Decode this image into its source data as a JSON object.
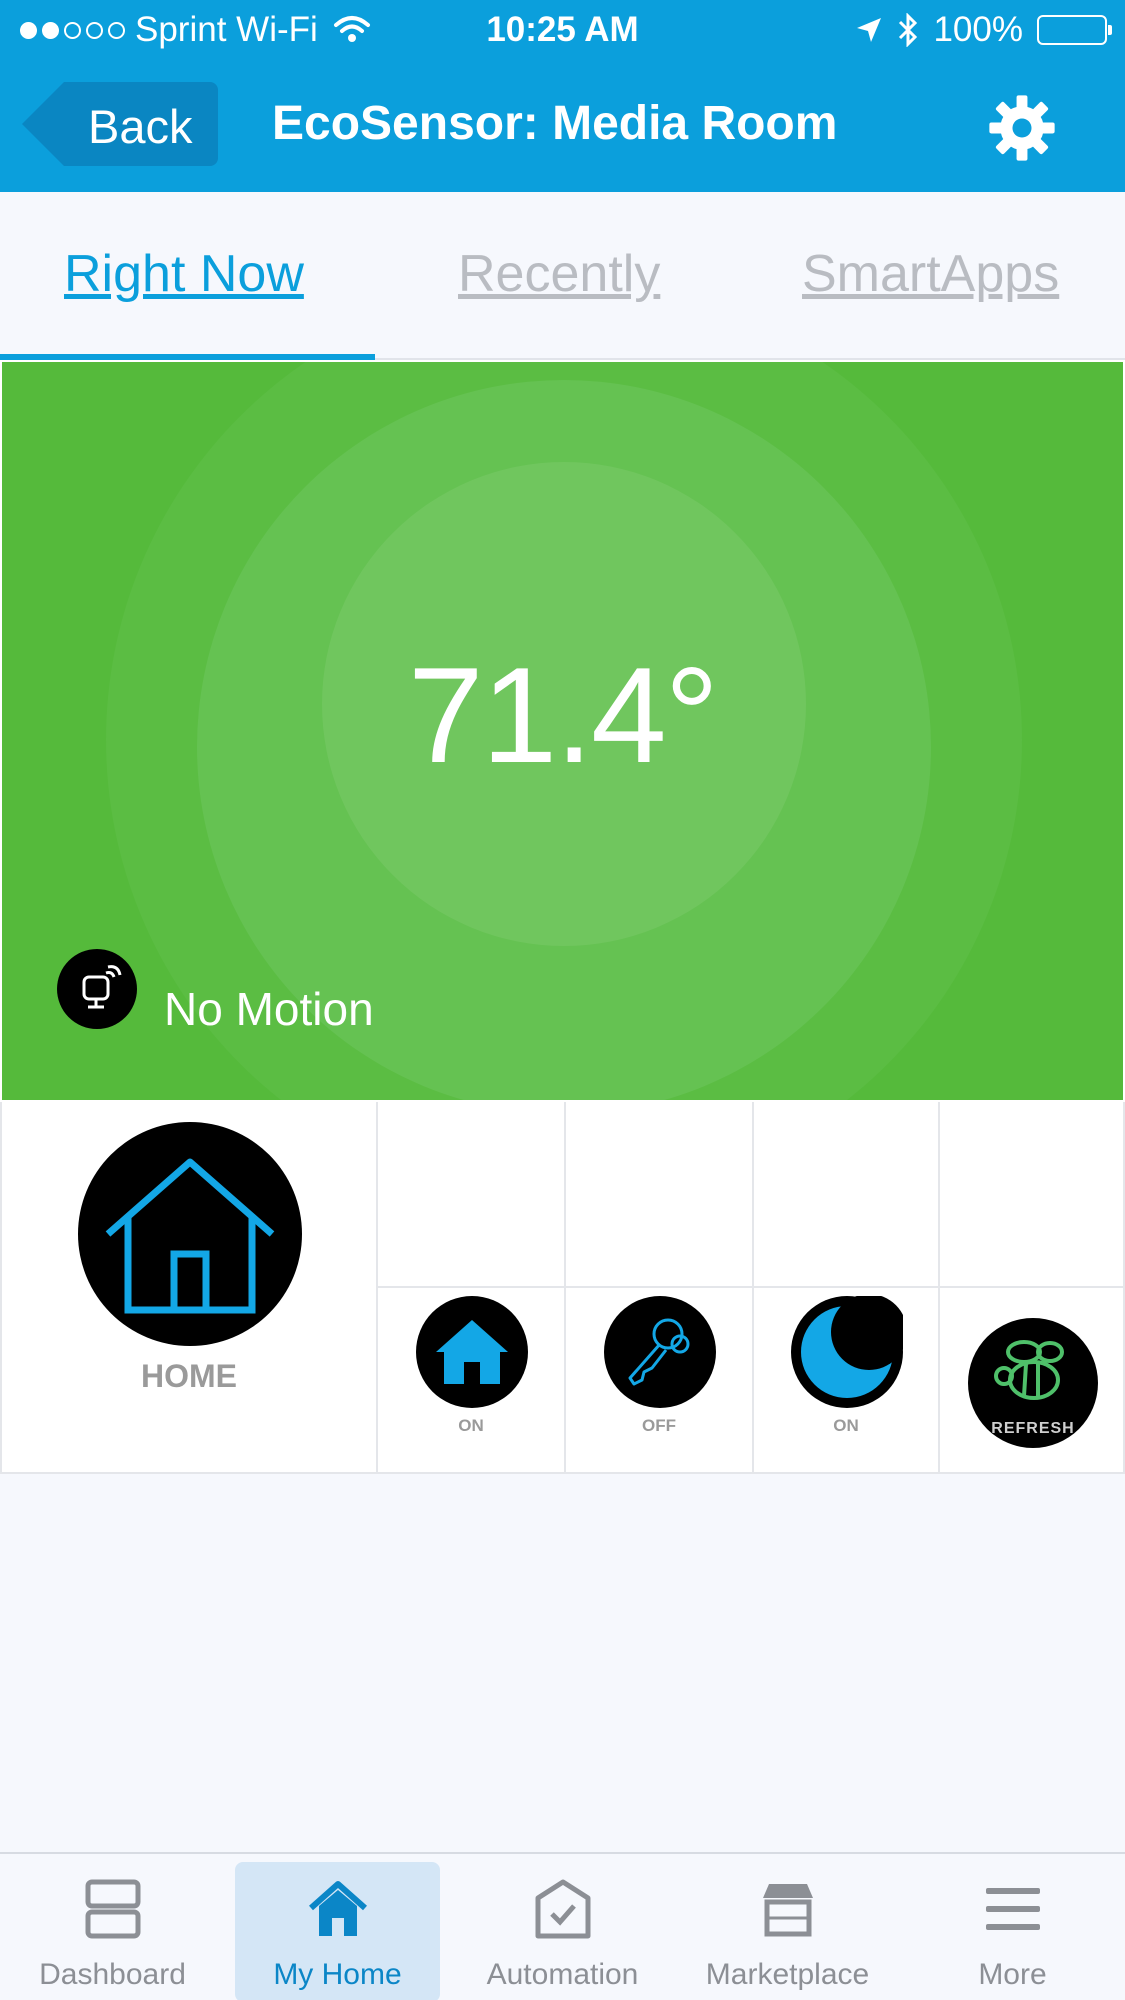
{
  "status_bar": {
    "carrier": "Sprint Wi-Fi",
    "time": "10:25 AM",
    "battery": "100%",
    "signal_bars": 2
  },
  "nav": {
    "back_label": "Back",
    "title": "EcoSensor: Media Room",
    "settings_icon": "gear-icon"
  },
  "tabs": [
    {
      "label": "Right Now",
      "active": true
    },
    {
      "label": "Recently",
      "active": false
    },
    {
      "label": "SmartApps",
      "active": false
    }
  ],
  "sensor": {
    "temperature": "71.4°",
    "motion_status": "No Motion",
    "background_color": "#55ba3b"
  },
  "tiles": {
    "main": {
      "label": "HOME",
      "icon": "house-outline-icon"
    },
    "actions": [
      {
        "label": "ON",
        "icon": "house-icon"
      },
      {
        "label": "OFF",
        "icon": "key-icon"
      },
      {
        "label": "ON",
        "icon": "moon-icon"
      },
      {
        "label": "REFRESH",
        "icon": "bee-icon"
      }
    ]
  },
  "tabbar": [
    {
      "label": "Dashboard",
      "icon": "dashboard-icon",
      "active": false
    },
    {
      "label": "My Home",
      "icon": "home-icon",
      "active": true
    },
    {
      "label": "Automation",
      "icon": "automation-icon",
      "active": false
    },
    {
      "label": "Marketplace",
      "icon": "marketplace-icon",
      "active": false
    },
    {
      "label": "More",
      "icon": "menu-icon",
      "active": false
    }
  ],
  "colors": {
    "accent": "#0b9fdc",
    "sensor_green": "#55ba3b",
    "tile_icon_blue": "#13a7e6"
  }
}
